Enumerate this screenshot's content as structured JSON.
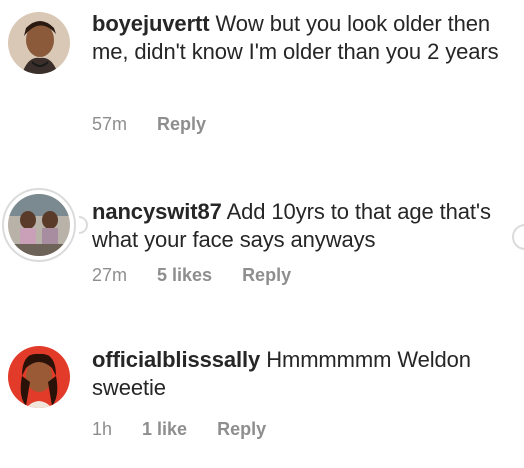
{
  "comments": [
    {
      "username": "boyejuvertt",
      "text": "Wow but you look older then me, didn't know I'm older than you 2 years",
      "time": "57m",
      "likes": "",
      "reply": "Reply"
    },
    {
      "username": "nancyswit87",
      "text": "Add 10yrs to that age that's what your face says anyways",
      "time": "27m",
      "likes": "5 likes",
      "reply": "Reply"
    },
    {
      "username": "officialblisssally",
      "text": "Hmmmmmm Weldon sweetie",
      "time": "1h",
      "likes": "1 like",
      "reply": "Reply"
    }
  ],
  "colors": {
    "text": "#262626",
    "muted": "#8e8e8e",
    "ring": "#dbdbdb"
  }
}
